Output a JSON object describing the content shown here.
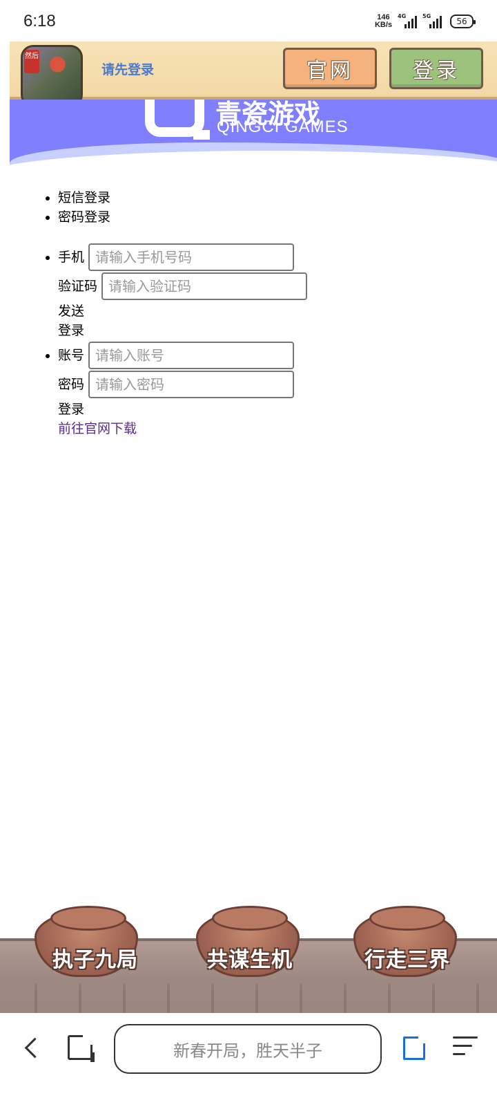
{
  "status_bar": {
    "time": "6:18",
    "net_speed_value": "146",
    "net_speed_unit": "KB/s",
    "sim1_tag": "4G",
    "sim2_tag": "5G",
    "battery": "56"
  },
  "header": {
    "app_badge": "然后",
    "login_hint": "请先登录",
    "official_button": "官网",
    "login_button": "登录"
  },
  "banner": {
    "brand_cn": "青瓷游戏",
    "brand_en": "QINGCI GAMES"
  },
  "login": {
    "tabs": [
      "短信登录",
      "密码登录"
    ],
    "sms_form": {
      "phone_label": "手机",
      "phone_placeholder": "请输入手机号码",
      "code_label": "验证码",
      "code_placeholder": "请输入验证码",
      "send_label": "发送",
      "submit_label": "登录"
    },
    "password_form": {
      "account_label": "账号",
      "account_placeholder": "请输入账号",
      "password_label": "密码",
      "password_placeholder": "请输入密码",
      "submit_label": "登录"
    },
    "download_link": "前往官网下载"
  },
  "game_art": {
    "labels": [
      "执子九局",
      "共谋生机",
      "行走三界"
    ]
  },
  "browser_bar": {
    "search_placeholder": "新春开局，胜天半子"
  },
  "colors": {
    "accent_blue": "#4b79d6",
    "banner_bg": "#8080ff",
    "official_button": "#f5b27c",
    "login_button": "#9cc27e",
    "link_purple": "#5a2a8a"
  }
}
